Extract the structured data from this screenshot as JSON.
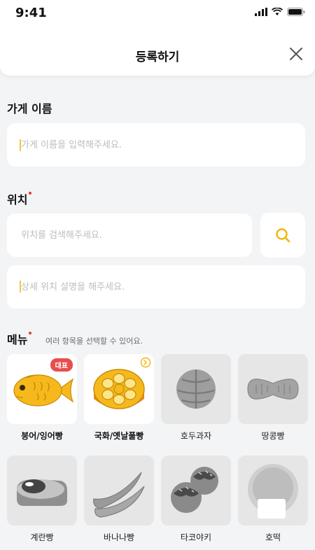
{
  "status": {
    "time": "9:41"
  },
  "header": {
    "title": "등록하기"
  },
  "store_name": {
    "label": "가게 이름",
    "placeholder": "가게 이름을 입력해주세요."
  },
  "location": {
    "label": "위치",
    "search_placeholder": "위치를 검색해주세요.",
    "detail_placeholder": "상세 위치 설명을 해주세요."
  },
  "menu": {
    "label": "메뉴",
    "hint": "여러 항목을 선택할 수 있어요.",
    "badge": "대표",
    "items": [
      {
        "name": "붕어/잉어빵",
        "icon": "fish-bread-icon",
        "selected": true
      },
      {
        "name": "국화/옛날풀빵",
        "icon": "flower-bread-icon",
        "selected": true
      },
      {
        "name": "호두과자",
        "icon": "walnut-cake-icon",
        "selected": false
      },
      {
        "name": "땅콩빵",
        "icon": "peanut-bread-icon",
        "selected": false
      },
      {
        "name": "계란빵",
        "icon": "egg-bread-icon",
        "selected": false
      },
      {
        "name": "바나나빵",
        "icon": "banana-bread-icon",
        "selected": false
      },
      {
        "name": "타코야키",
        "icon": "takoyaki-icon",
        "selected": false
      },
      {
        "name": "호떡",
        "icon": "hotteok-icon",
        "selected": false
      }
    ]
  },
  "colors": {
    "accent": "#f4b400",
    "required": "#e53935",
    "badge": "#e84e4e",
    "background": "#f3f4f6"
  }
}
